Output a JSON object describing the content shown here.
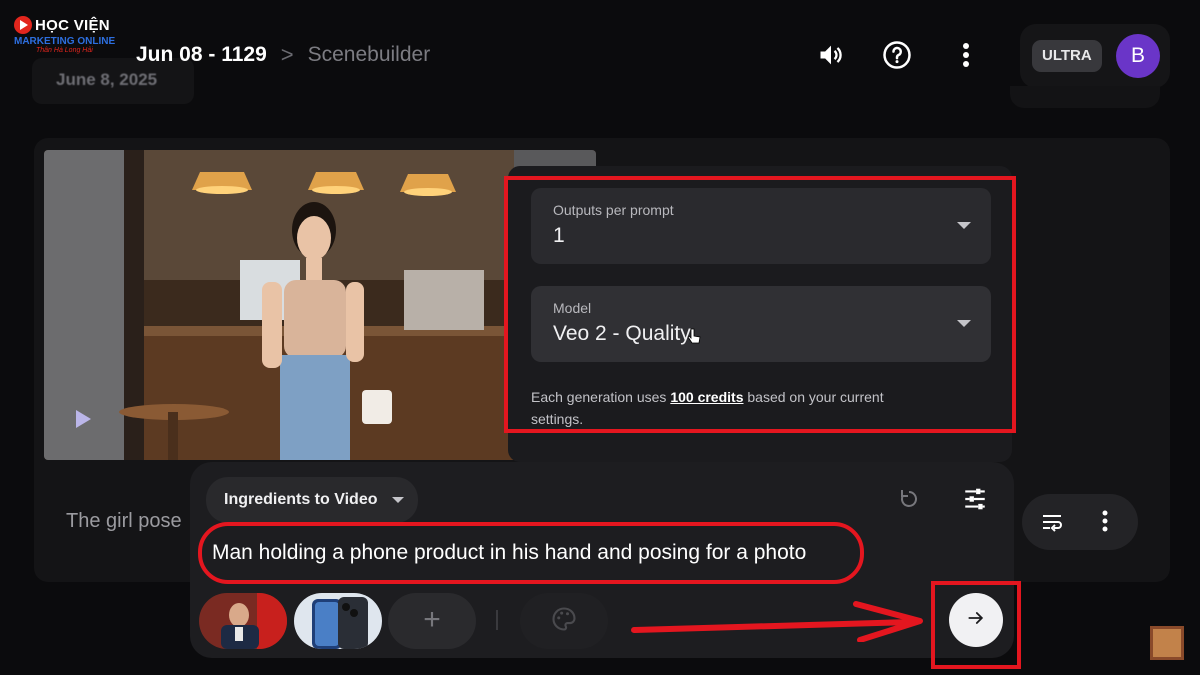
{
  "brand": {
    "name": "HỌC VIỆN",
    "subtitle": "MARKETING ONLINE",
    "tagline": "Thân Hà Long Hải"
  },
  "header": {
    "project_title": "Jun 08 - 1129",
    "separator": ">",
    "page_name": "Scenebuilder",
    "date_chip": "June 8, 2025",
    "plan_badge": "ULTRA",
    "avatar_initial": "B",
    "icons": [
      "speaker-icon",
      "help-icon",
      "more-vert-icon"
    ]
  },
  "scene": {
    "caption": "The girl pose"
  },
  "settings": {
    "outputs_label": "Outputs per prompt",
    "outputs_value": "1",
    "model_label": "Model",
    "model_value": "Veo 2 - Quality",
    "credits_prefix": "Each generation uses ",
    "credits_amount": "100 credits",
    "credits_suffix": " based on your current settings."
  },
  "composer": {
    "mode_label": "Ingredients to Video",
    "prompt_value": "Man holding a phone product in his hand and posing for a photo",
    "add_label": "+",
    "icons": [
      "refresh-icon",
      "tune-icon",
      "palette-icon",
      "arrow-right-icon"
    ]
  },
  "colors": {
    "annotation_red": "#e4161f",
    "avatar_purple": "#6a35c8",
    "background": "#0b0b0d"
  }
}
